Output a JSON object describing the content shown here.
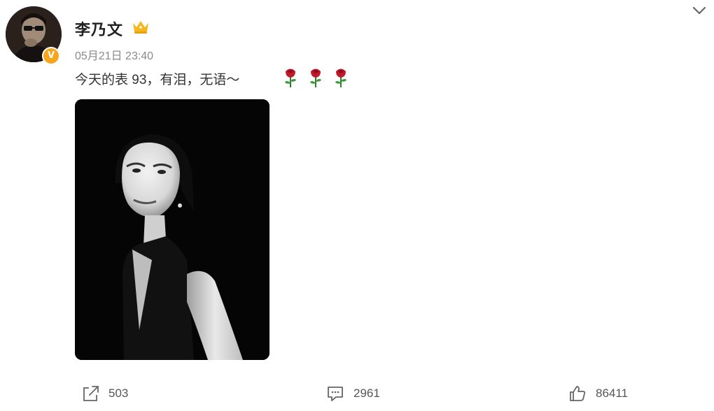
{
  "post": {
    "author": "李乃文",
    "time": "05月21日 23:40",
    "text": "今天的表 93，有泪，无语～",
    "emojis": [
      "rose",
      "rose",
      "rose"
    ]
  },
  "actions": {
    "share_count": "503",
    "comment_count": "2961",
    "like_count": "86411"
  },
  "icons": {
    "badge": "verified-v-icon",
    "crown": "crown-icon",
    "chevron": "chevron-down-icon",
    "share": "share-icon",
    "comment": "comment-icon",
    "like": "thumbs-up-icon"
  },
  "colors": {
    "badge": "#f7a51c",
    "crown": "#f5b71f",
    "rose": "#c0192b",
    "muted_text": "#8a8a8a"
  }
}
